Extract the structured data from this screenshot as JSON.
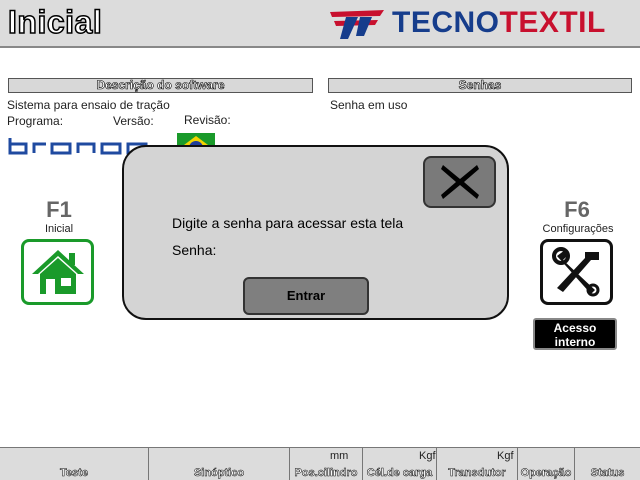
{
  "header": {
    "title": "Inicial",
    "brand_part1": "TECNO",
    "brand_part2": "TEXTIL",
    "brand_color_blue": "#163d8c",
    "brand_color_red": "#c8102e"
  },
  "software": {
    "section_title": "Descrição do software",
    "description": "Sistema para ensaio de tração",
    "program_label": "Programa:",
    "version_label": "Versão:",
    "revision_label": "Revisão:"
  },
  "passwords": {
    "section_title": "Senhas",
    "status": "Senha em uso"
  },
  "tiles": {
    "f1_key": "F1",
    "f1_label": "Inicial",
    "f1_icon": "home-icon",
    "f6_key": "F6",
    "f6_label": "Configurações",
    "f6_icon": "tools-icon",
    "internal_access_line1": "Acesso",
    "internal_access_line2": "interno"
  },
  "dialog": {
    "message": "Digite a senha para acessar esta tela",
    "password_label": "Senha:",
    "enter_button": "Entrar",
    "close_icon": "close-icon"
  },
  "bottom_bar": {
    "items": [
      {
        "label": "Teste",
        "unit": ""
      },
      {
        "label": "Sinóptico",
        "unit": ""
      },
      {
        "label": "Pos.cilindro",
        "unit": "mm"
      },
      {
        "label": "Cél.de carga",
        "unit": "Kgf"
      },
      {
        "label": "Transdutor",
        "unit": "Kgf"
      },
      {
        "label": "Operação",
        "unit": ""
      },
      {
        "label": "Status",
        "unit": ""
      }
    ]
  }
}
